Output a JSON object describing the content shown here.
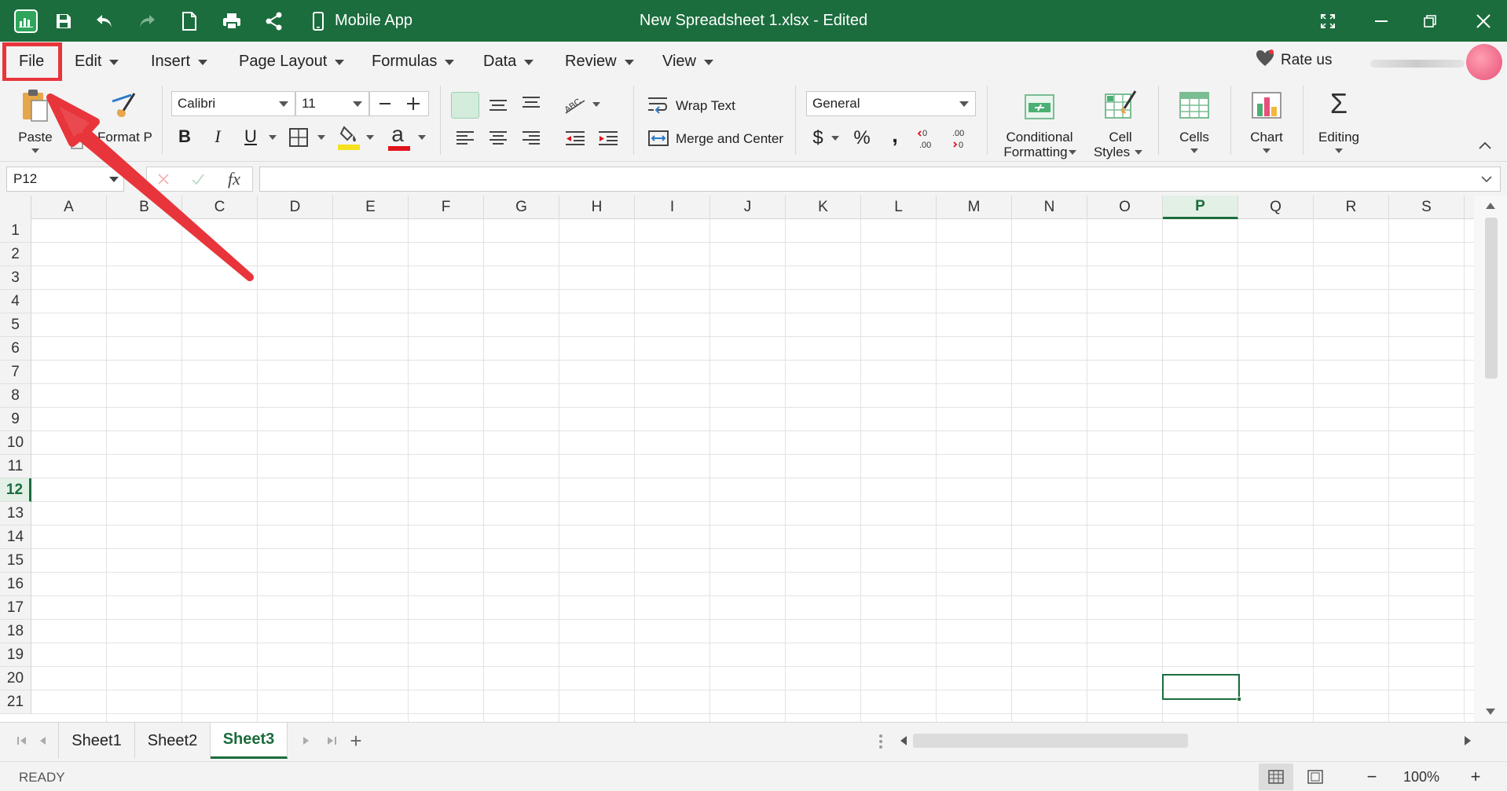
{
  "titlebar": {
    "mobile_app_label": "Mobile App",
    "document_title": "New Spreadsheet 1.xlsx - Edited",
    "bg_color": "#1b6d3d"
  },
  "menu": {
    "file": "File",
    "edit": "Edit",
    "insert": "Insert",
    "page_layout": "Page Layout",
    "formulas": "Formulas",
    "data": "Data",
    "review": "Review",
    "view": "View",
    "rate_us": "Rate us"
  },
  "ribbon": {
    "paste": "Paste",
    "format_painter": "Format Painter",
    "font_name": "Calibri",
    "font_size": "11",
    "wrap_text": "Wrap Text",
    "merge_center": "Merge and Center",
    "number_format": "General",
    "conditional_formatting_line1": "Conditional",
    "conditional_formatting_line2": "Formatting",
    "cell_styles_line1": "Cell",
    "cell_styles_line2": "Styles",
    "cells": "Cells",
    "chart": "Chart",
    "editing": "Editing",
    "bold": "B",
    "italic": "I",
    "underline": "U",
    "font_color_glyph": "a",
    "currency": "$",
    "percent": "%",
    "comma": ",",
    "sum_glyph": "Σ",
    "abc": "ABC",
    "fx": "fx"
  },
  "formula_bar": {
    "name_box": "P12",
    "formula": ""
  },
  "grid": {
    "columns": [
      "A",
      "B",
      "C",
      "D",
      "E",
      "F",
      "G",
      "H",
      "I",
      "J",
      "K",
      "L",
      "M",
      "N",
      "O",
      "P",
      "Q",
      "R",
      "S"
    ],
    "rows": [
      "1",
      "2",
      "3",
      "4",
      "5",
      "6",
      "7",
      "8",
      "9",
      "10",
      "11",
      "12",
      "13",
      "14",
      "15",
      "16",
      "17",
      "18",
      "19",
      "20",
      "21"
    ],
    "active_column": "P",
    "active_row": "12"
  },
  "sheets": {
    "tabs": [
      "Sheet1",
      "Sheet2",
      "Sheet3"
    ],
    "active": "Sheet3",
    "add_glyph": "+"
  },
  "status": {
    "ready": "READY",
    "zoom": "100%",
    "zoom_out": "−",
    "zoom_in": "+"
  },
  "colors": {
    "accent": "#1b6d3d",
    "annotation": "#e8353b"
  }
}
